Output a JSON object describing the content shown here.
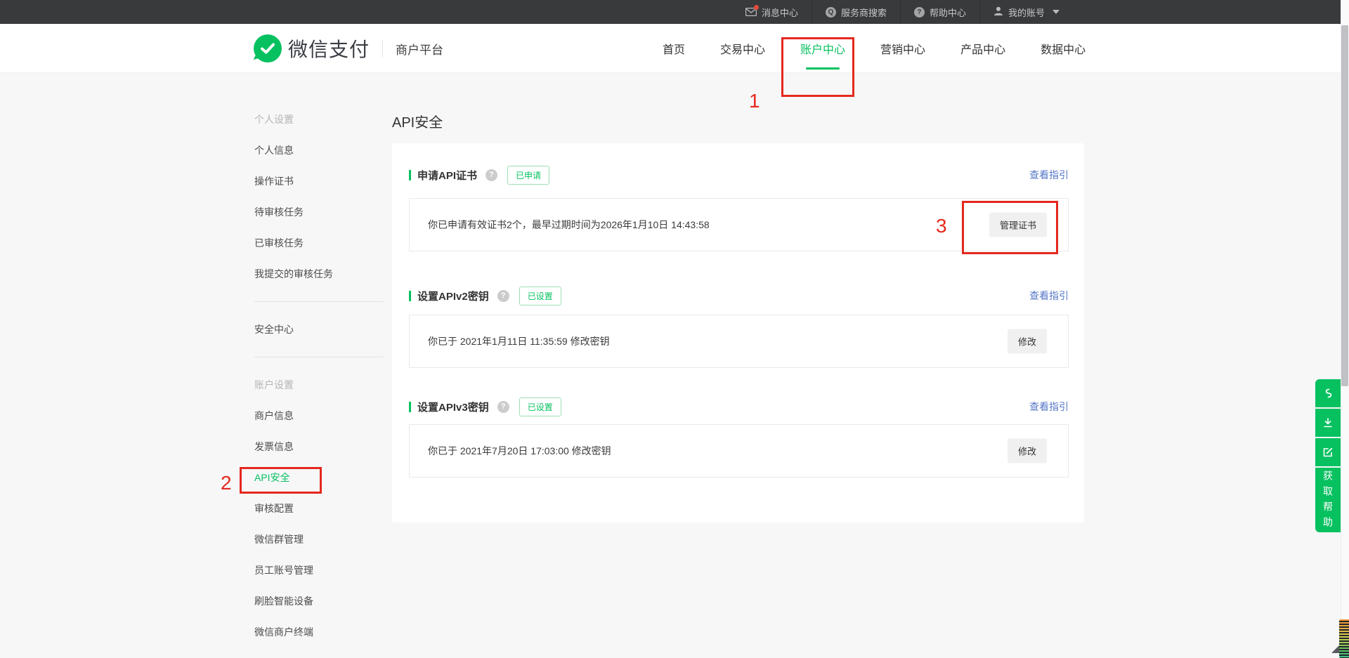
{
  "topbar": {
    "items": [
      {
        "label": "消息中心",
        "icon": "mail-icon"
      },
      {
        "label": "服务商搜索",
        "icon": "provider-search-icon",
        "glyph": "Q"
      },
      {
        "label": "帮助中心",
        "icon": "help-icon",
        "glyph": "?"
      },
      {
        "label": "我的账号",
        "icon": "account-icon"
      }
    ]
  },
  "header": {
    "brand": "微信支付",
    "platform": "商户平台",
    "nav": [
      {
        "label": "首页"
      },
      {
        "label": "交易中心"
      },
      {
        "label": "账户中心",
        "active": true
      },
      {
        "label": "营销中心"
      },
      {
        "label": "产品中心"
      },
      {
        "label": "数据中心"
      }
    ]
  },
  "sidebar": {
    "groups": [
      {
        "header": "个人设置",
        "items": [
          "个人信息",
          "操作证书",
          "待审核任务",
          "已审核任务",
          "我提交的审核任务"
        ]
      },
      {
        "items": [
          "安全中心"
        ]
      },
      {
        "header": "账户设置",
        "items": [
          "商户信息",
          "发票信息",
          "API安全",
          "审核配置",
          "微信群管理",
          "员工账号管理",
          "刷脸智能设备",
          "微信商户终端"
        ]
      }
    ],
    "active_item": "API安全"
  },
  "main": {
    "page_title": "API安全",
    "help_glyph": "?",
    "sections": [
      {
        "title": "申请API证书",
        "status_badge": "已申请",
        "guide_link": "查看指引",
        "row_text": "你已申请有效证书2个，最早过期时间为2026年1月10日 14:43:58",
        "action_button": "管理证书"
      },
      {
        "title": "设置APIv2密钥",
        "status_badge": "已设置",
        "guide_link": "查看指引",
        "row_text": "你已于 2021年1月11日 11:35:59 修改密钥",
        "action_button": "修改"
      },
      {
        "title": "设置APIv3密钥",
        "status_badge": "已设置",
        "guide_link": "查看指引",
        "row_text": "你已于 2021年7月20日 17:03:00 修改密钥",
        "action_button": "修改"
      }
    ]
  },
  "floating": {
    "help_label": "获取帮助",
    "icons": [
      "link-icon",
      "download-icon",
      "edit-icon"
    ]
  },
  "annotations": {
    "step1": "1",
    "step2": "2",
    "step3": "3"
  },
  "colors": {
    "accent_green": "#07c160",
    "annotation_red": "#e5281e",
    "link_blue": "#5577c8",
    "topbar_bg": "#393a3c"
  }
}
